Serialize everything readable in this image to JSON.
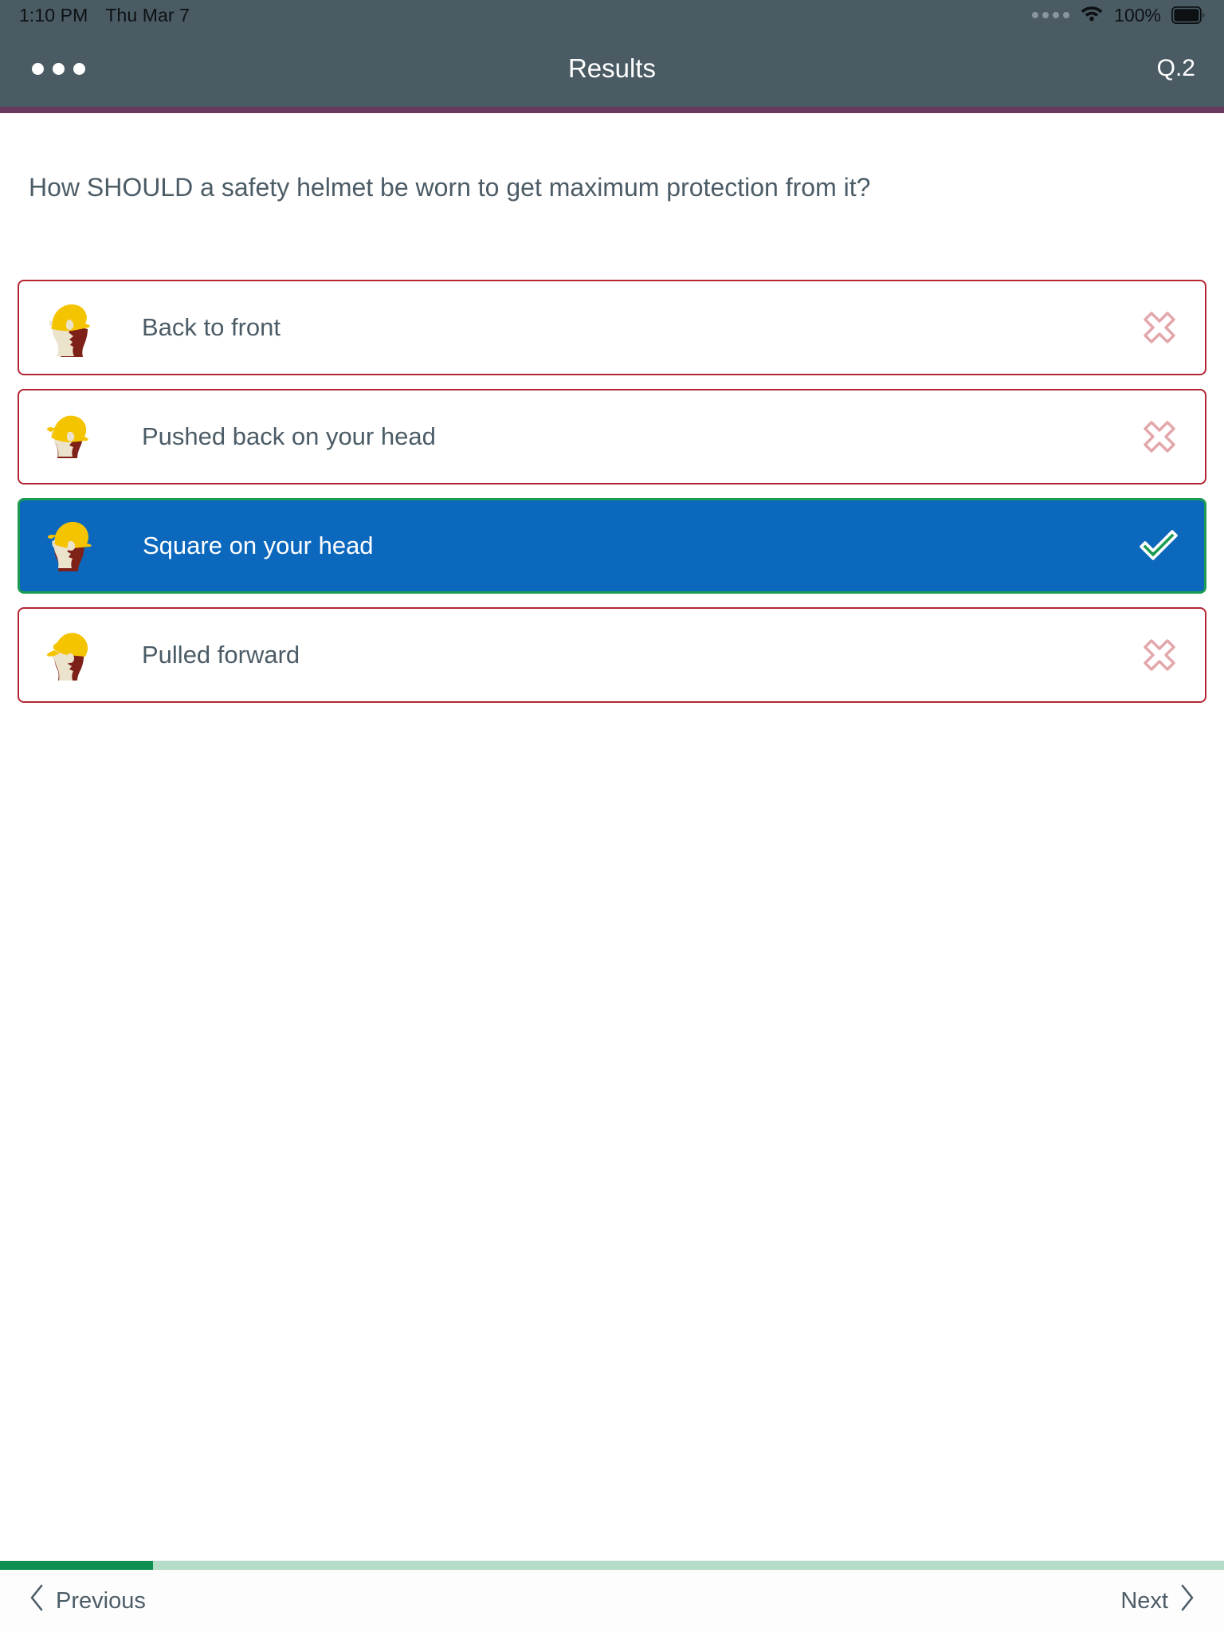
{
  "status_bar": {
    "time": "1:10 PM",
    "date": "Thu Mar 7",
    "battery_percent": "100%",
    "signal_icon": "cellular-signal-dots-icon",
    "wifi_icon": "wifi-icon",
    "battery_icon": "battery-full-icon"
  },
  "nav_bar": {
    "menu_icon": "more-options-dots-icon",
    "title": "Results",
    "question_indicator": "Q.2",
    "accent_color": "#69395f",
    "background_color": "#4b5b64"
  },
  "question": {
    "text": "How SHOULD a safety helmet be worn to get maximum protection from it?"
  },
  "options": [
    {
      "label": "Back to front",
      "icon": "helmet-back-to-front-icon",
      "state": "incorrect",
      "mark_icon": "cross-icon",
      "border_color": "#b32633"
    },
    {
      "label": "Pushed back on your head",
      "icon": "helmet-pushed-back-icon",
      "state": "incorrect",
      "mark_icon": "cross-icon",
      "border_color": "#b32633"
    },
    {
      "label": "Square on your head",
      "icon": "helmet-square-on-head-icon",
      "state": "correct",
      "mark_icon": "checkmark-icon",
      "border_color": "#1a9c54",
      "background_color": "#0b68bd"
    },
    {
      "label": "Pulled forward",
      "icon": "helmet-pulled-forward-icon",
      "state": "incorrect",
      "mark_icon": "cross-icon",
      "border_color": "#b32633"
    }
  ],
  "progress": {
    "percent": 12.5,
    "fill_color": "#0e9150",
    "track_color": "#b3ddc6"
  },
  "bottom_bar": {
    "previous_label": "Previous",
    "previous_icon": "chevron-left-icon",
    "next_label": "Next",
    "next_icon": "chevron-right-icon"
  },
  "colors": {
    "text": "#4c5c66",
    "incorrect": "#b32633",
    "correct_green": "#1a9c54",
    "selected_blue": "#0b68bd",
    "cross_pink": "#e3a6ab",
    "helmet_yellow": "#f5c400",
    "skin": "#ece3cd",
    "hair": "#7e2118"
  }
}
